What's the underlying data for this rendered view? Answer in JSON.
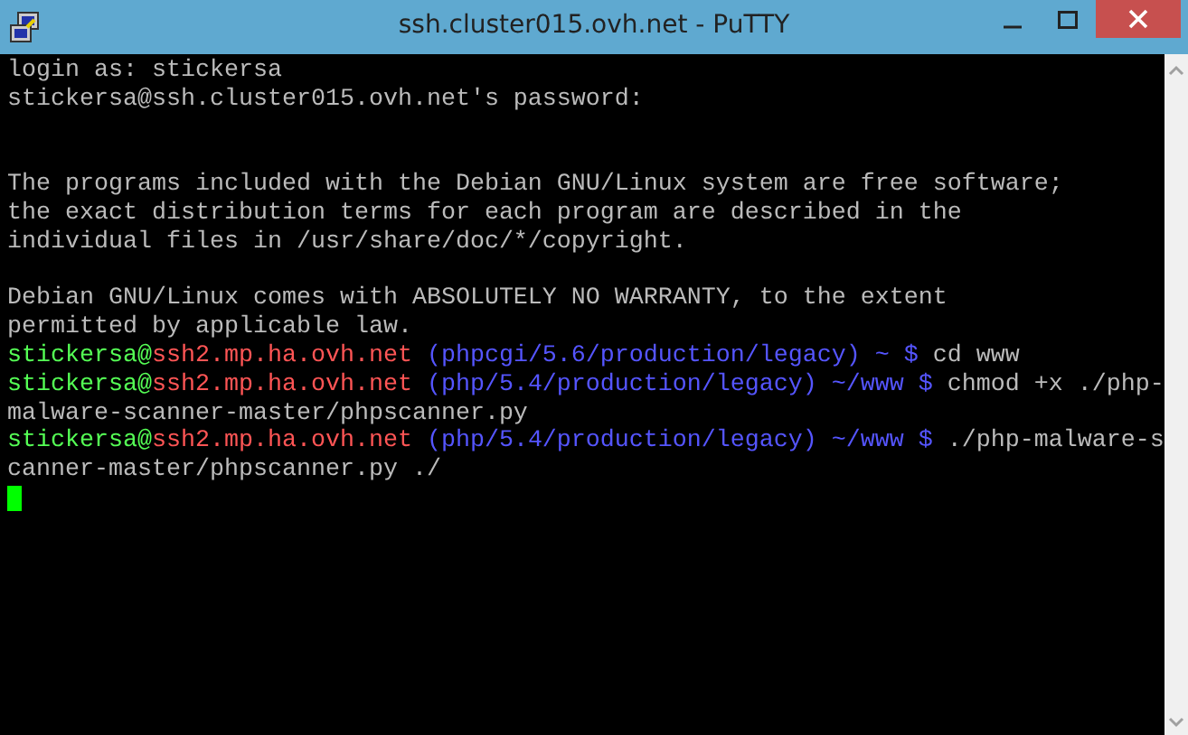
{
  "window": {
    "title": "ssh.cluster015.ovh.net - PuTTY"
  },
  "terminal": {
    "lines": [
      {
        "kind": "text",
        "segments": [
          {
            "kind": "plain",
            "text": "login as: stickersa"
          }
        ]
      },
      {
        "kind": "text",
        "segments": [
          {
            "kind": "plain",
            "text": "stickersa@ssh.cluster015.ovh.net's password:"
          }
        ]
      },
      {
        "kind": "blank"
      },
      {
        "kind": "blank"
      },
      {
        "kind": "text",
        "segments": [
          {
            "kind": "plain",
            "text": "The programs included with the Debian GNU/Linux system are free software;"
          }
        ]
      },
      {
        "kind": "text",
        "segments": [
          {
            "kind": "plain",
            "text": "the exact distribution terms for each program are described in the"
          }
        ]
      },
      {
        "kind": "text",
        "segments": [
          {
            "kind": "plain",
            "text": "individual files in /usr/share/doc/*/copyright."
          }
        ]
      },
      {
        "kind": "blank"
      },
      {
        "kind": "text",
        "segments": [
          {
            "kind": "plain",
            "text": "Debian GNU/Linux comes with ABSOLUTELY NO WARRANTY, to the extent"
          }
        ]
      },
      {
        "kind": "text",
        "segments": [
          {
            "kind": "plain",
            "text": "permitted by applicable law."
          }
        ]
      },
      {
        "kind": "text",
        "segments": [
          {
            "kind": "user",
            "text": "stickersa@"
          },
          {
            "kind": "host",
            "text": "ssh2.mp.ha.ovh.net"
          },
          {
            "kind": "path",
            "text": " (phpcgi/5.6/production/legacy) ~ $"
          },
          {
            "kind": "plain",
            "text": " cd www"
          }
        ]
      },
      {
        "kind": "text",
        "segments": [
          {
            "kind": "user",
            "text": "stickersa@"
          },
          {
            "kind": "host",
            "text": "ssh2.mp.ha.ovh.net"
          },
          {
            "kind": "path",
            "text": " (php/5.4/production/legacy) ~/www $"
          },
          {
            "kind": "plain",
            "text": " chmod +x ./php-"
          }
        ]
      },
      {
        "kind": "text",
        "segments": [
          {
            "kind": "plain",
            "text": "malware-scanner-master/phpscanner.py"
          }
        ]
      },
      {
        "kind": "text",
        "segments": [
          {
            "kind": "user",
            "text": "stickersa@"
          },
          {
            "kind": "host",
            "text": "ssh2.mp.ha.ovh.net"
          },
          {
            "kind": "path",
            "text": " (php/5.4/production/legacy) ~/www $"
          },
          {
            "kind": "plain",
            "text": " ./php-malware-s"
          }
        ]
      },
      {
        "kind": "text",
        "segments": [
          {
            "kind": "plain",
            "text": "canner-master/phpscanner.py ./"
          }
        ]
      },
      {
        "kind": "cursor"
      }
    ]
  }
}
